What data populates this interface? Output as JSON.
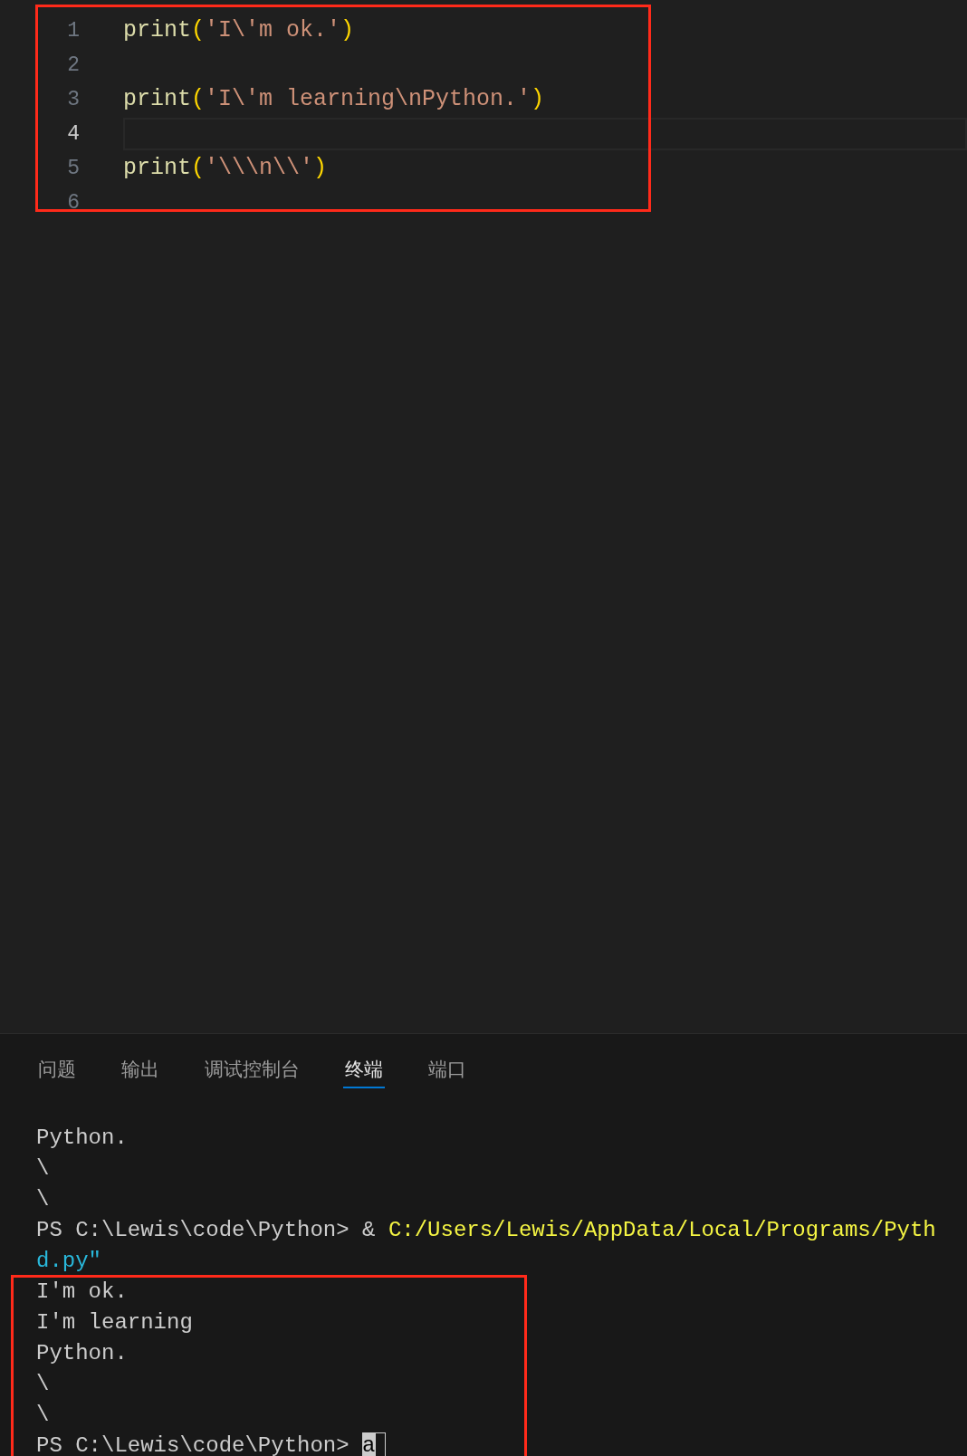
{
  "editor": {
    "lines": [
      {
        "number": "1",
        "current": false,
        "tokens": [
          {
            "kind": "function",
            "text": "print"
          },
          {
            "kind": "paren",
            "text": "("
          },
          {
            "kind": "string",
            "text": "'I\\'m ok.'"
          },
          {
            "kind": "paren",
            "text": ")"
          }
        ]
      },
      {
        "number": "2",
        "current": false
      },
      {
        "number": "3",
        "current": false,
        "tokens": [
          {
            "kind": "function",
            "text": "print"
          },
          {
            "kind": "paren",
            "text": "("
          },
          {
            "kind": "string",
            "text": "'I\\'m learning\\nPython.'"
          },
          {
            "kind": "paren",
            "text": ")"
          }
        ]
      },
      {
        "number": "4",
        "current": true
      },
      {
        "number": "5",
        "current": false,
        "tokens": [
          {
            "kind": "function",
            "text": "print"
          },
          {
            "kind": "paren",
            "text": "("
          },
          {
            "kind": "string",
            "text": "'\\\\\\n\\\\'"
          },
          {
            "kind": "paren",
            "text": ")"
          }
        ]
      },
      {
        "number": "6",
        "current": false
      }
    ]
  },
  "panel": {
    "tabs": [
      {
        "label": "问题",
        "selected": false
      },
      {
        "label": "输出",
        "selected": false
      },
      {
        "label": "调试控制台",
        "selected": false
      },
      {
        "label": "终端",
        "selected": true
      },
      {
        "label": "端口",
        "selected": false
      }
    ],
    "terminal": [
      [
        {
          "kind": "plain",
          "text": "Python."
        }
      ],
      [
        {
          "kind": "plain",
          "text": "\\"
        }
      ],
      [
        {
          "kind": "plain",
          "text": "\\"
        }
      ],
      [
        {
          "kind": "plain",
          "text": "PS C:\\Lewis\\code\\Python> & "
        },
        {
          "kind": "command",
          "text": "C:/Users/Lewis/AppData/Local/Programs/Pyth"
        }
      ],
      [
        {
          "kind": "string",
          "text": "d.py\""
        }
      ],
      [
        {
          "kind": "plain",
          "text": "I'm ok."
        }
      ],
      [
        {
          "kind": "plain",
          "text": "I'm learning"
        }
      ],
      [
        {
          "kind": "plain",
          "text": "Python."
        }
      ],
      [
        {
          "kind": "plain",
          "text": "\\"
        }
      ],
      [
        {
          "kind": "plain",
          "text": "\\"
        }
      ],
      [
        {
          "kind": "plain",
          "text": "PS C:\\Lewis\\code\\Python> "
        },
        {
          "kind": "cursor",
          "text": "a"
        }
      ]
    ]
  }
}
